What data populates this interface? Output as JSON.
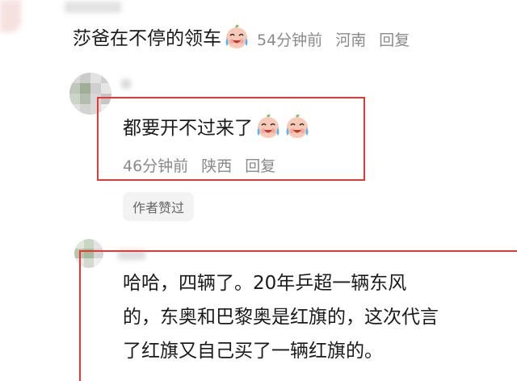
{
  "comment_top": {
    "text": "莎爸在不停的领车",
    "emoji_icon": "crying-laughing-face-icon",
    "time": "54分钟前",
    "location": "河南",
    "reply_label": "回复"
  },
  "reply_one": {
    "text": "都要开不过来了",
    "emoji_icon": "crying-laughing-face-icon",
    "time": "46分钟前",
    "location": "陕西",
    "reply_label": "回复",
    "author_liked_badge": "作者赞过"
  },
  "reply_two": {
    "lines": [
      "哈哈，四辆了。20年乒超一辆东风",
      "的，东奥和巴黎奥是红旗的，这次代言",
      "了红旗又自己买了一辆红旗的。"
    ]
  },
  "colors": {
    "highlight_box": "#e53935",
    "meta_text": "#8a8a8a",
    "badge_bg": "#f3f3f3"
  }
}
